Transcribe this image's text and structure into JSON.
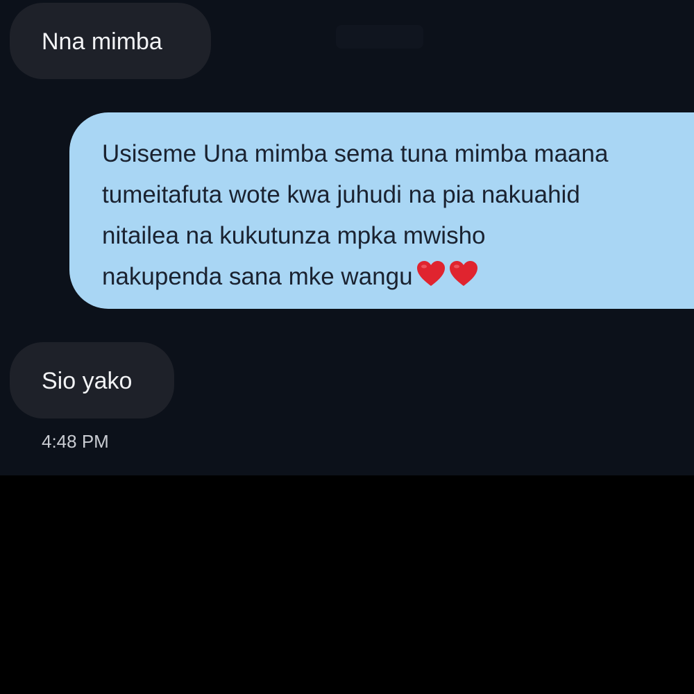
{
  "conversation": {
    "messages": [
      {
        "direction": "incoming",
        "text": "Nna mimba"
      },
      {
        "direction": "outgoing",
        "text": "Usiseme Una mimba sema tuna mimba maana\ntumeitafuta wote kwa juhudi na pia nakuahid\nnitailea na kukutunza mpka mwisho\nnakupenda sana mke wangu",
        "emoji": [
          "red-heart-icon",
          "red-heart-icon"
        ]
      },
      {
        "direction": "incoming",
        "text": "Sio yako"
      }
    ],
    "timestamp": "4:48 PM"
  },
  "colors": {
    "chat_background": "#0c111a",
    "incoming_bubble": "#1e2129",
    "outgoing_bubble": "#a9d6f4",
    "heart": "#e0242f"
  }
}
